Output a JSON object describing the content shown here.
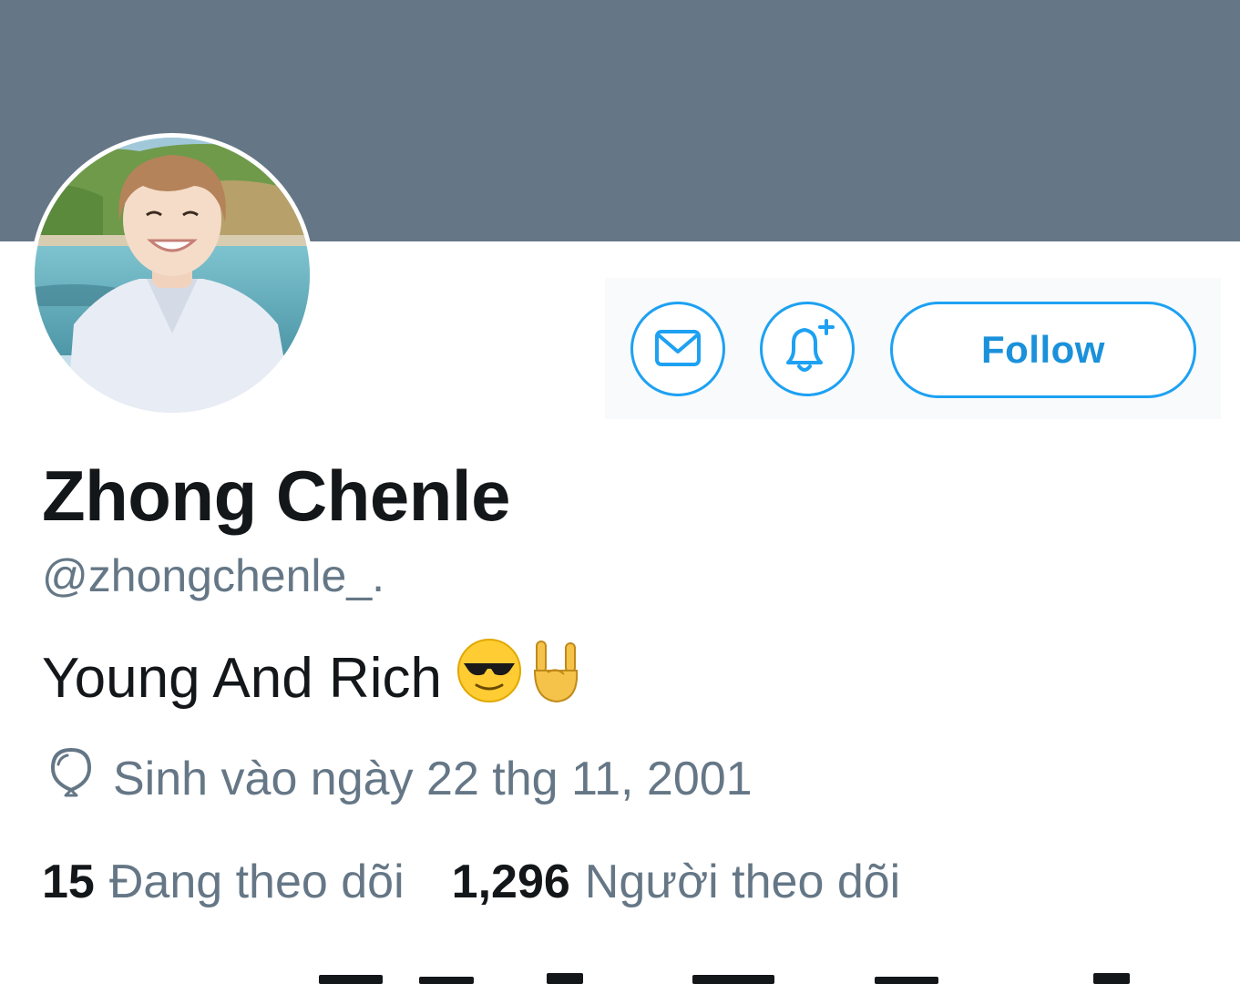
{
  "profile": {
    "display_name": "Zhong Chenle",
    "handle": "@zhongchenle_.",
    "bio": "Young And Rich",
    "bio_emojis": [
      "smiling-face-with-sunglasses",
      "sign-of-the-horns"
    ],
    "birthday": "Sinh vào ngày 22 thg 11, 2001"
  },
  "actions": {
    "follow_label": "Follow"
  },
  "stats": {
    "following_count": "15",
    "following_label": "Đang theo dõi",
    "followers_count": "1,296",
    "followers_label": "Người theo dõi"
  },
  "icons": {
    "message": "envelope-icon",
    "notifications": "bell-plus-icon",
    "birthday": "balloon-icon"
  },
  "colors": {
    "banner": "#657786",
    "accent": "#1da1f2",
    "text_primary": "#14171a",
    "text_secondary": "#657786"
  }
}
